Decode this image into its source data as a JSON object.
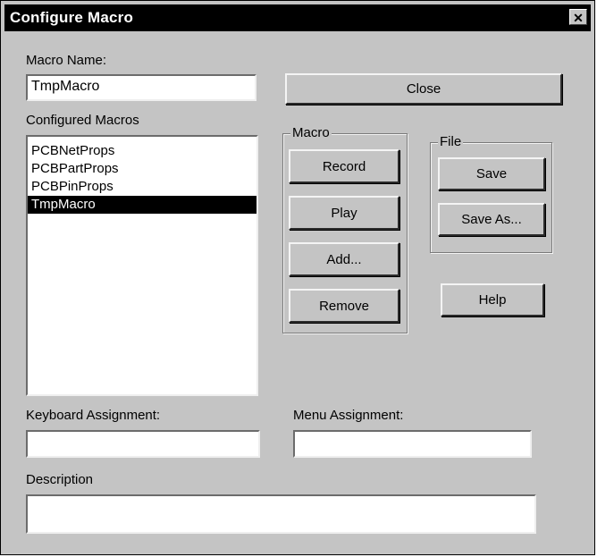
{
  "window": {
    "title": "Configure Macro"
  },
  "macro_name": {
    "label": "Macro Name:",
    "value": "TmpMacro"
  },
  "configured_macros": {
    "label": "Configured Macros",
    "items": [
      "PCBNetProps",
      "PCBPartProps",
      "PCBPinProps",
      "TmpMacro"
    ],
    "selected": "TmpMacro"
  },
  "buttons": {
    "close": "Close",
    "record": "Record",
    "play": "Play",
    "add": "Add...",
    "remove": "Remove",
    "save": "Save",
    "save_as": "Save As...",
    "help": "Help"
  },
  "groups": {
    "macro": "Macro",
    "file": "File"
  },
  "keyboard_assignment": {
    "label": "Keyboard Assignment:",
    "value": ""
  },
  "menu_assignment": {
    "label": "Menu Assignment:",
    "value": ""
  },
  "description": {
    "label": "Description",
    "value": ""
  },
  "icons": {
    "title_close": "close-icon"
  }
}
